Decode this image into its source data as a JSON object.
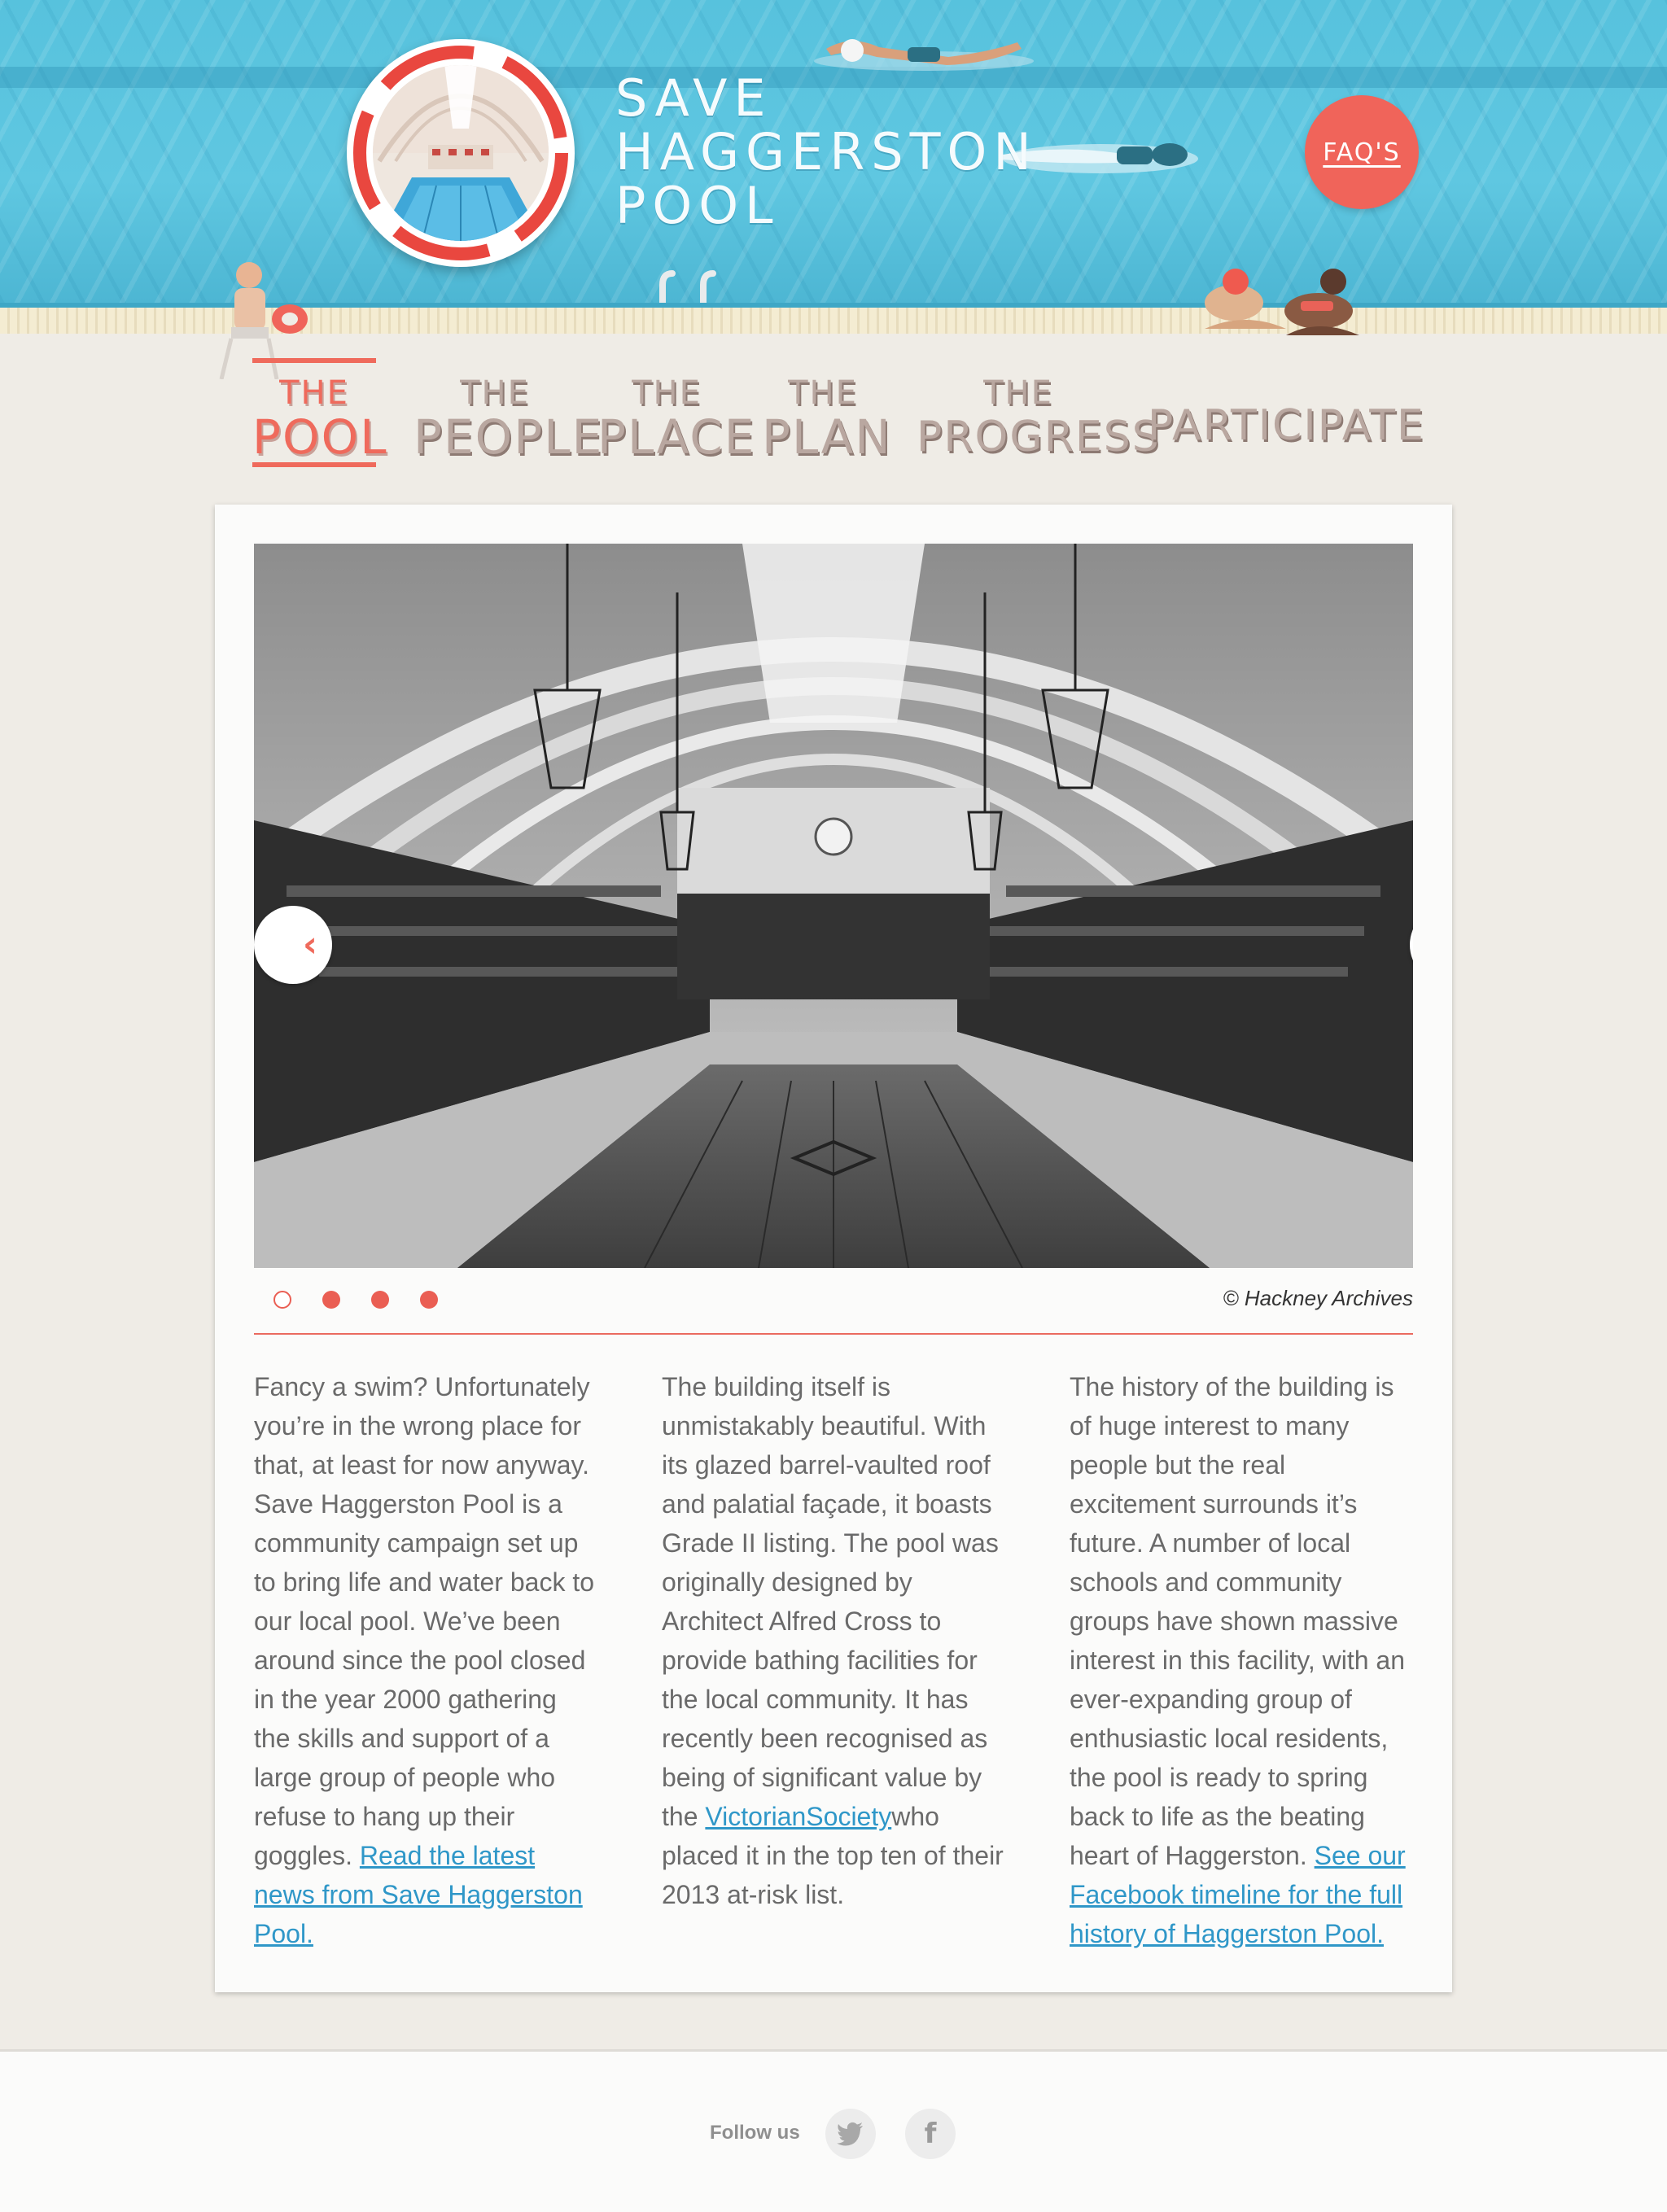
{
  "header": {
    "title_lines": [
      "Save",
      "Haggerston",
      "Pool"
    ],
    "faq_label": "FAQ'S"
  },
  "nav": {
    "items": [
      {
        "small": "The",
        "big": "Pool",
        "active": true
      },
      {
        "small": "The",
        "big": "People",
        "active": false
      },
      {
        "small": "The",
        "big": "Place",
        "active": false
      },
      {
        "small": "The",
        "big": "Plan",
        "active": false
      },
      {
        "small": "The",
        "big": "Progress",
        "active": false
      },
      {
        "small": "",
        "big": "Participate",
        "active": false
      }
    ]
  },
  "slider": {
    "prev_icon": "chevron-left-icon",
    "next_icon": "chevron-right-icon",
    "prev_glyph": "‹",
    "next_glyph": "›",
    "slide_count": 4,
    "active_slide": 1,
    "credit": "© Hackney Archives"
  },
  "content": {
    "col1_text": "Fancy a swim? Unfortunately you’re in the wrong place for that, at least for now anyway. Save Haggerston Pool is a community campaign set up to bring life and water back to our local pool. We’ve been around since the pool closed in the year 2000 gathering the skills and support of a large group of people who refuse to hang up their goggles. ",
    "col1_link": "Read the latest news from Save Haggerston Pool.",
    "col2_text_before": "The building itself is unmistakably beautiful. With its glazed barrel-vaulted roof and palatial façade, it boasts Grade II listing. The pool was originally designed by Architect Alfred Cross to provide bathing facilities for the local community. It has recently been recognised as being of significant value by the ",
    "col2_link": "VictorianSociety",
    "col2_text_after": "who placed it in the top ten of their 2013 at-risk list.",
    "col3_text": "The history of the building is of huge interest to many people but the real excitement surrounds it’s future. A number of local schools and community groups have shown massive interest in this facility, with an ever-expanding group of enthusiastic local residents, the pool is ready to spring back to life as the beating heart of Haggerston. ",
    "col3_link": "See our Facebook timeline for the full history of Haggerston Pool."
  },
  "footer": {
    "follow_label": "Follow us",
    "twitter_icon": "twitter-icon",
    "facebook_icon": "facebook-icon",
    "facebook_glyph": "f"
  },
  "colors": {
    "accent": "#ef6a5c",
    "pool_blue": "#5fc7e1",
    "link": "#2f97c8",
    "body_text": "#6a6a6a",
    "background": "#efece6"
  }
}
